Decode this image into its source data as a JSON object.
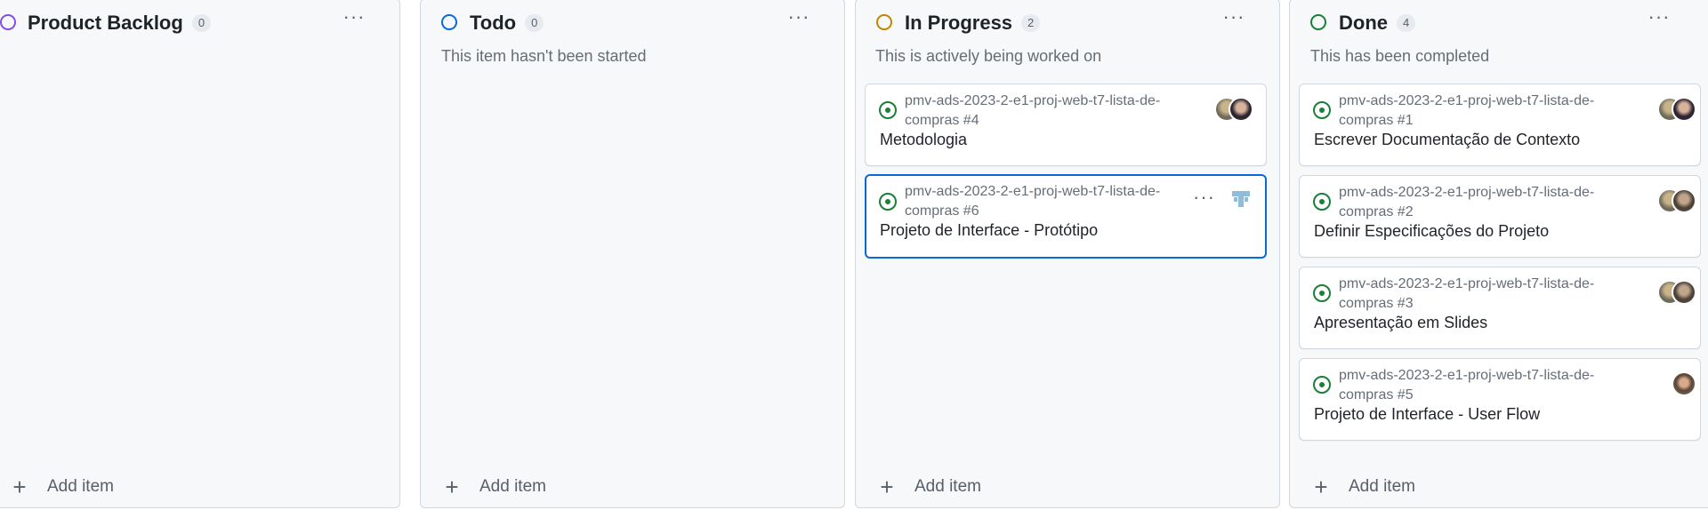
{
  "columns": [
    {
      "title": "Product Backlog",
      "count": "0",
      "description": "",
      "status_color": "#8250df",
      "add_item_label": "Add item",
      "cards": []
    },
    {
      "title": "Todo",
      "count": "0",
      "description": "This item hasn't been started",
      "status_color": "#0969da",
      "add_item_label": "Add item",
      "cards": []
    },
    {
      "title": "In Progress",
      "count": "2",
      "description": "This is actively being worked on",
      "status_color": "#bf8700",
      "add_item_label": "Add item",
      "cards": [
        {
          "repo": "pmv-ads-2023-2-e1-proj-web-t7-lista-de-compras #4",
          "title": "Metodologia"
        },
        {
          "repo": "pmv-ads-2023-2-e1-proj-web-t7-lista-de-compras #6",
          "title": "Projeto de Interface - Protótipo"
        }
      ]
    },
    {
      "title": "Done",
      "count": "4",
      "description": "This has been completed",
      "status_color": "#1a7f37",
      "add_item_label": "Add item",
      "cards": [
        {
          "repo": "pmv-ads-2023-2-e1-proj-web-t7-lista-de-compras #1",
          "title": "Escrever Documentação de Contexto"
        },
        {
          "repo": "pmv-ads-2023-2-e1-proj-web-t7-lista-de-compras #2",
          "title": "Definir Especificações do Projeto"
        },
        {
          "repo": "pmv-ads-2023-2-e1-proj-web-t7-lista-de-compras #3",
          "title": "Apresentação em Slides"
        },
        {
          "repo": "pmv-ads-2023-2-e1-proj-web-t7-lista-de-compras #5",
          "title": "Projeto de Interface - User Flow"
        }
      ]
    }
  ],
  "icons": {
    "column_menu": "kebab-horizontal-icon",
    "issue_status": "issue-open-icon",
    "add": "plus-icon"
  },
  "colors": {
    "issue_open": "#1a7f37",
    "selected_border": "#0969da"
  }
}
